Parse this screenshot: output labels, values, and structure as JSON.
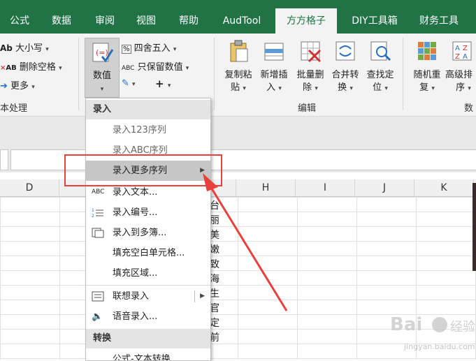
{
  "tabs": [
    "公式",
    "数据",
    "审阅",
    "视图",
    "帮助",
    "AudTool",
    "方方格子",
    "DIY工具箱",
    "财务工具"
  ],
  "ribbon": {
    "case_btn": "大小写",
    "remove_space_btn": "删除空格",
    "more_btn": "更多",
    "text_group_label": "本处理",
    "value_btn": "数值",
    "round_btn": "四舍五入",
    "keep_value_btn": "只保留数值",
    "plus_btn": "+",
    "copy_paste_btn": [
      "复制粘",
      "贴"
    ],
    "insert_btn": [
      "新增插",
      "入"
    ],
    "batch_delete_btn": [
      "批量删",
      "除"
    ],
    "merge_convert_btn": [
      "合并转",
      "换"
    ],
    "find_locate_btn": [
      "查找定",
      "位"
    ],
    "edit_group_label": "编辑",
    "random_btn": [
      "随机重",
      "复"
    ],
    "advanced_sort_btn": [
      "高级排",
      "序"
    ],
    "data_group_label": "数"
  },
  "columns": [
    "D",
    "H",
    "I",
    "J",
    "K"
  ],
  "cell_chars": [
    "台",
    "丽",
    "美",
    "嫩",
    "致",
    "海",
    "生",
    "官",
    "定",
    "前"
  ],
  "menu": {
    "section1": "录入",
    "items": [
      {
        "label": "录入123序列"
      },
      {
        "label": "录入ABC序列"
      },
      {
        "label": "录入更多序列"
      },
      {
        "label": "录入文本..."
      },
      {
        "label": "录入编号..."
      },
      {
        "label": "录入到多簿..."
      },
      {
        "label": "填充空白单元格..."
      },
      {
        "label": "填充区域..."
      },
      {
        "label": "联想录入"
      },
      {
        "label": "语音录入..."
      }
    ],
    "section2": "转换",
    "last_item": "公式-文本转换"
  },
  "watermark": {
    "brand": "Bai",
    "brand2": "经验",
    "url": "jingyan.baidu.com"
  },
  "colors": {
    "excel_green": "#217346",
    "highlight_red": "#e8403c"
  }
}
